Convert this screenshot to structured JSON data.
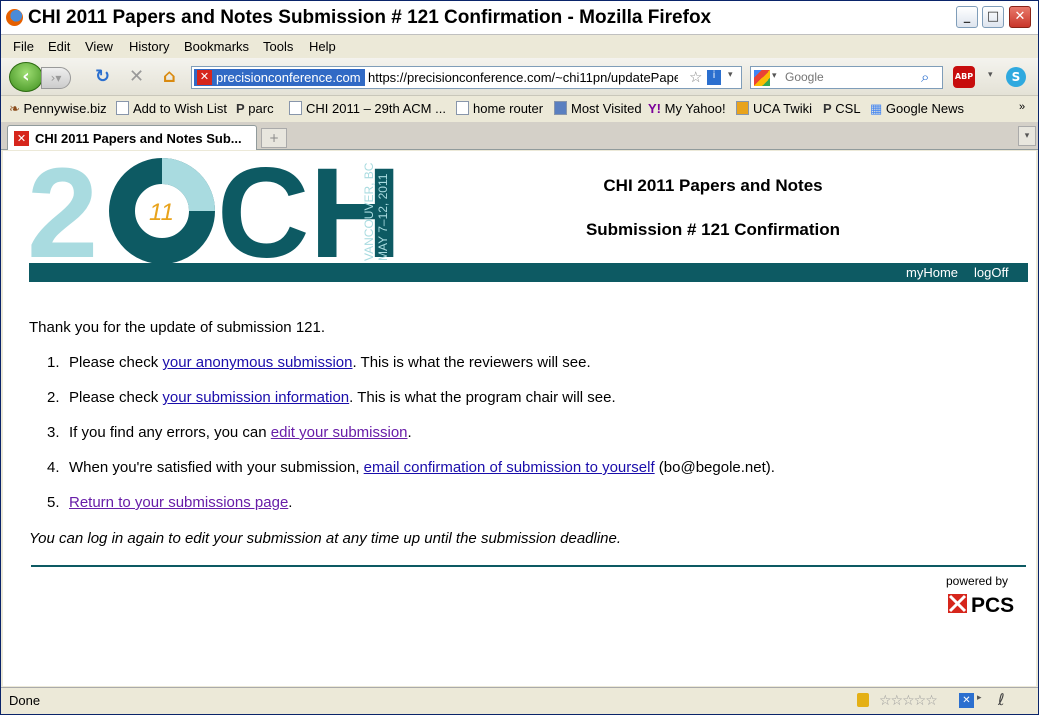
{
  "window": {
    "title": "CHI 2011 Papers and Notes Submission # 121 Confirmation - Mozilla Firefox"
  },
  "menu": [
    "File",
    "Edit",
    "View",
    "History",
    "Bookmarks",
    "Tools",
    "Help"
  ],
  "nav": {
    "site_identity": "precisionconference.com",
    "url": "https://precisionconference.com/~chi11pn/updatePape",
    "search_placeholder": "Google"
  },
  "bookmarks": [
    "Pennywise.biz",
    "Add to Wish List",
    "parc",
    "CHI 2011 – 29th ACM ...",
    "home router",
    "Most Visited",
    "My Yahoo!",
    "UCA Twiki",
    "CSL",
    "Google News"
  ],
  "tab": {
    "label": "CHI 2011 Papers and Notes Sub..."
  },
  "page": {
    "logo": {
      "year_left": "2",
      "year_small": "11",
      "brand": "CHI",
      "side_line1": "VANCOUVER, BC",
      "side_line2": "MAY 7–12, 2011"
    },
    "heading1": "CHI 2011 Papers and Notes",
    "heading2": "Submission # 121 Confirmation",
    "nav_links": {
      "home": "myHome",
      "logoff": "logOff"
    },
    "thanks": "Thank you for the update of submission 121.",
    "items": [
      {
        "num": "1.",
        "pre": "Please check ",
        "link": "your anonymous submission",
        "post": ". This is what the reviewers will see."
      },
      {
        "num": "2.",
        "pre": "Please check ",
        "link": "your submission information",
        "post": ". This is what the program chair will see."
      },
      {
        "num": "3.",
        "pre": "If you find any errors, you can ",
        "link": "edit your submission",
        "post": "."
      },
      {
        "num": "4.",
        "pre": "When you're satisfied with your submission, ",
        "link": "email confirmation of submission to yourself",
        "post": " (bo@begole.net)."
      },
      {
        "num": "5.",
        "pre": "",
        "link": "Return to your submissions page",
        "post": "."
      }
    ],
    "note": "You can log in again to edit your submission at any time up until the submission deadline.",
    "powered_by": "powered by",
    "pcs": "PCS"
  },
  "status": {
    "text": "Done"
  },
  "colors": {
    "teal": "#0d5a63",
    "light_teal": "#a9dbe0",
    "logo_gold": "#e8a31c"
  }
}
